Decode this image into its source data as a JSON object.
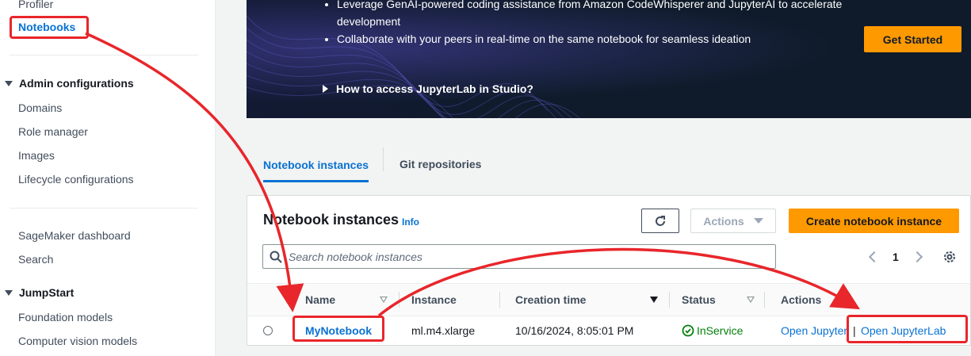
{
  "sidebar": {
    "profiler": "Profiler",
    "notebooks": "Notebooks",
    "admin_section": "Admin configurations",
    "admin_items": [
      "Domains",
      "Role manager",
      "Images",
      "Lifecycle configurations"
    ],
    "dashboard": "SageMaker dashboard",
    "search": "Search",
    "jumpstart_section": "JumpStart",
    "jumpstart_items": [
      "Foundation models",
      "Computer vision models"
    ]
  },
  "hero": {
    "bullets": [
      "Leverage GenAI-powered coding assistance from Amazon CodeWhisperer and JupyterAI to accelerate development",
      "Collaborate with your peers in real-time on the same notebook for seamless ideation"
    ],
    "get_started": "Get Started",
    "howto": "How to access JupyterLab in Studio?"
  },
  "tabs": [
    {
      "label": "Notebook instances",
      "active": true
    },
    {
      "label": "Git repositories",
      "active": false
    }
  ],
  "panel": {
    "title": "Notebook instances",
    "info": "Info",
    "actions_label": "Actions",
    "create_label": "Create notebook instance",
    "search_placeholder": "Search notebook instances",
    "page": "1"
  },
  "table": {
    "headers": [
      "Name",
      "Instance",
      "Creation time",
      "Status",
      "Actions"
    ],
    "rows": [
      {
        "name": "MyNotebook",
        "instance": "ml.m4.xlarge",
        "creation_time": "10/16/2024, 8:05:01 PM",
        "status": "InService",
        "action_jupyter": "Open Jupyter",
        "action_sep": "|",
        "action_jupyterlab": "Open JupyterLab"
      }
    ]
  },
  "colors": {
    "accent_link": "#0972d3",
    "primary_button": "#ff9900",
    "status_ok": "#037f0c",
    "annotation_red": "#e8262b",
    "hero_bg": "#0f1b2a"
  },
  "icons": [
    "refresh-icon",
    "search-icon",
    "settings-icon",
    "status-check-icon",
    "chevron-left-icon",
    "chevron-right-icon"
  ]
}
